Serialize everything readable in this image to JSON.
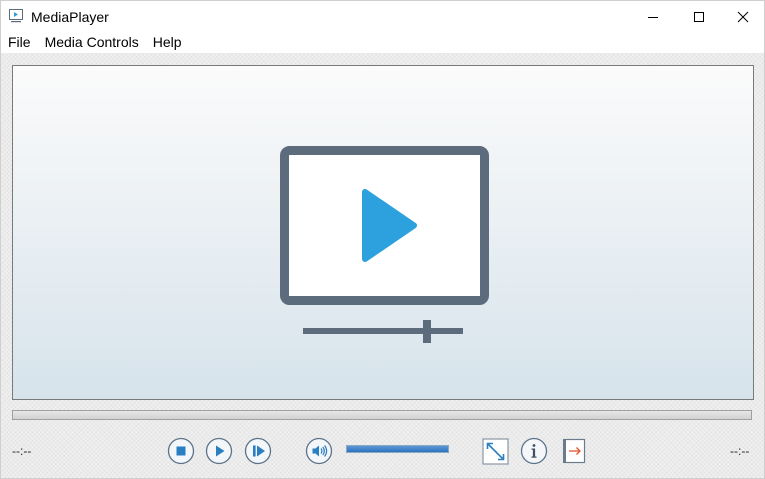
{
  "window": {
    "title": "MediaPlayer",
    "icon": "media-player-app-icon"
  },
  "titlebar_buttons": [
    "minimize-icon",
    "maximize-icon",
    "close-icon"
  ],
  "menu": {
    "items": [
      {
        "label": "File"
      },
      {
        "label": "Media Controls"
      },
      {
        "label": "Help"
      }
    ]
  },
  "video": {
    "placeholder_icon": "monitor-play-icon"
  },
  "seek": {
    "progress": 0
  },
  "controls": {
    "time_elapsed": "--:--",
    "time_total": "--:--",
    "buttons": [
      "stop-icon",
      "play-icon",
      "step-forward-icon",
      "volume-icon",
      "fullscreen-icon",
      "info-icon",
      "exit-icon"
    ],
    "volume_level": 1.0
  },
  "colors": {
    "accent_blue": "#2ca1dd",
    "illustration_slate": "#5d6c7d",
    "control_blue": "#2a7fc1"
  }
}
